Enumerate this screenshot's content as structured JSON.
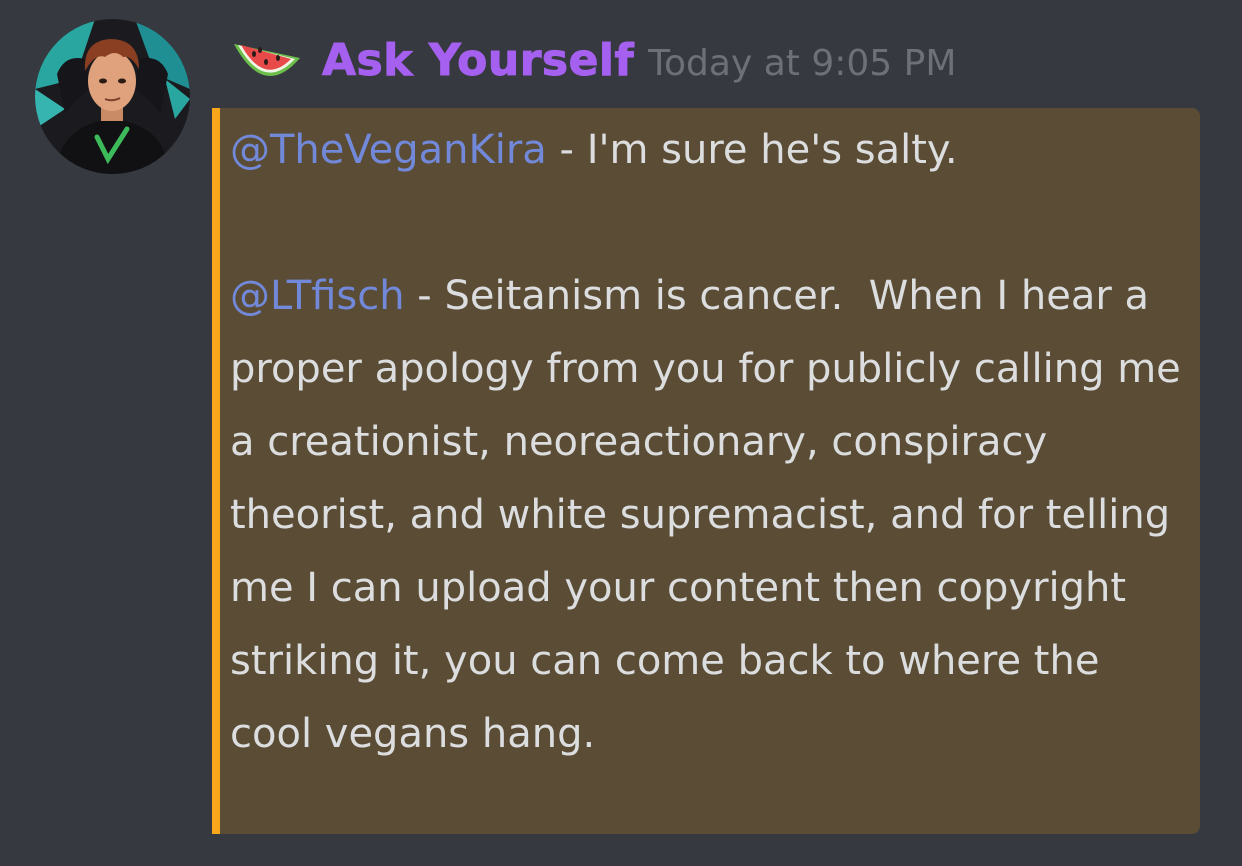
{
  "message": {
    "author": {
      "name": "Ask Yourself",
      "avatar_icon": "cartoon-portrait-avatar",
      "server_icon": "watermelon-icon",
      "name_color": "#a560f0"
    },
    "timestamp": "Today at 9:05 PM",
    "highlight": {
      "background": "#5a4c35",
      "bar_color": "#faa61a"
    },
    "paragraphs": [
      {
        "mention": "@TheVeganKira",
        "text": " - I'm sure he's salty."
      },
      {
        "mention": "@LTfisch",
        "text": " - Seitanism is cancer.  When I hear a proper apology from you for publicly calling me a creationist, neoreactionary, conspiracy theorist, and white supremacist, and for telling me I can upload your content then copyright striking it, you can come back to where the cool vegans hang."
      }
    ]
  }
}
